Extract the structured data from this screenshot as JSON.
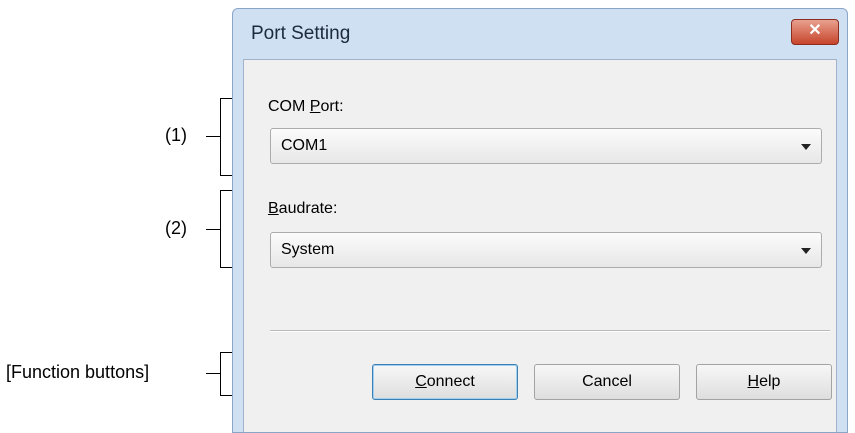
{
  "annotations": {
    "port": "(1)",
    "baudrate": "(2)",
    "buttons": "[Function buttons]"
  },
  "window": {
    "title": "Port Setting",
    "close_glyph": "✕"
  },
  "com_port": {
    "label_pre": "COM ",
    "label_accel": "P",
    "label_post": "ort:",
    "value": "COM1"
  },
  "baudrate": {
    "label_accel": "B",
    "label_post": "audrate:",
    "value": "System"
  },
  "buttons": {
    "connect_accel": "C",
    "connect_rest": "onnect",
    "cancel": "Cancel",
    "help_accel": "H",
    "help_rest": "elp"
  }
}
